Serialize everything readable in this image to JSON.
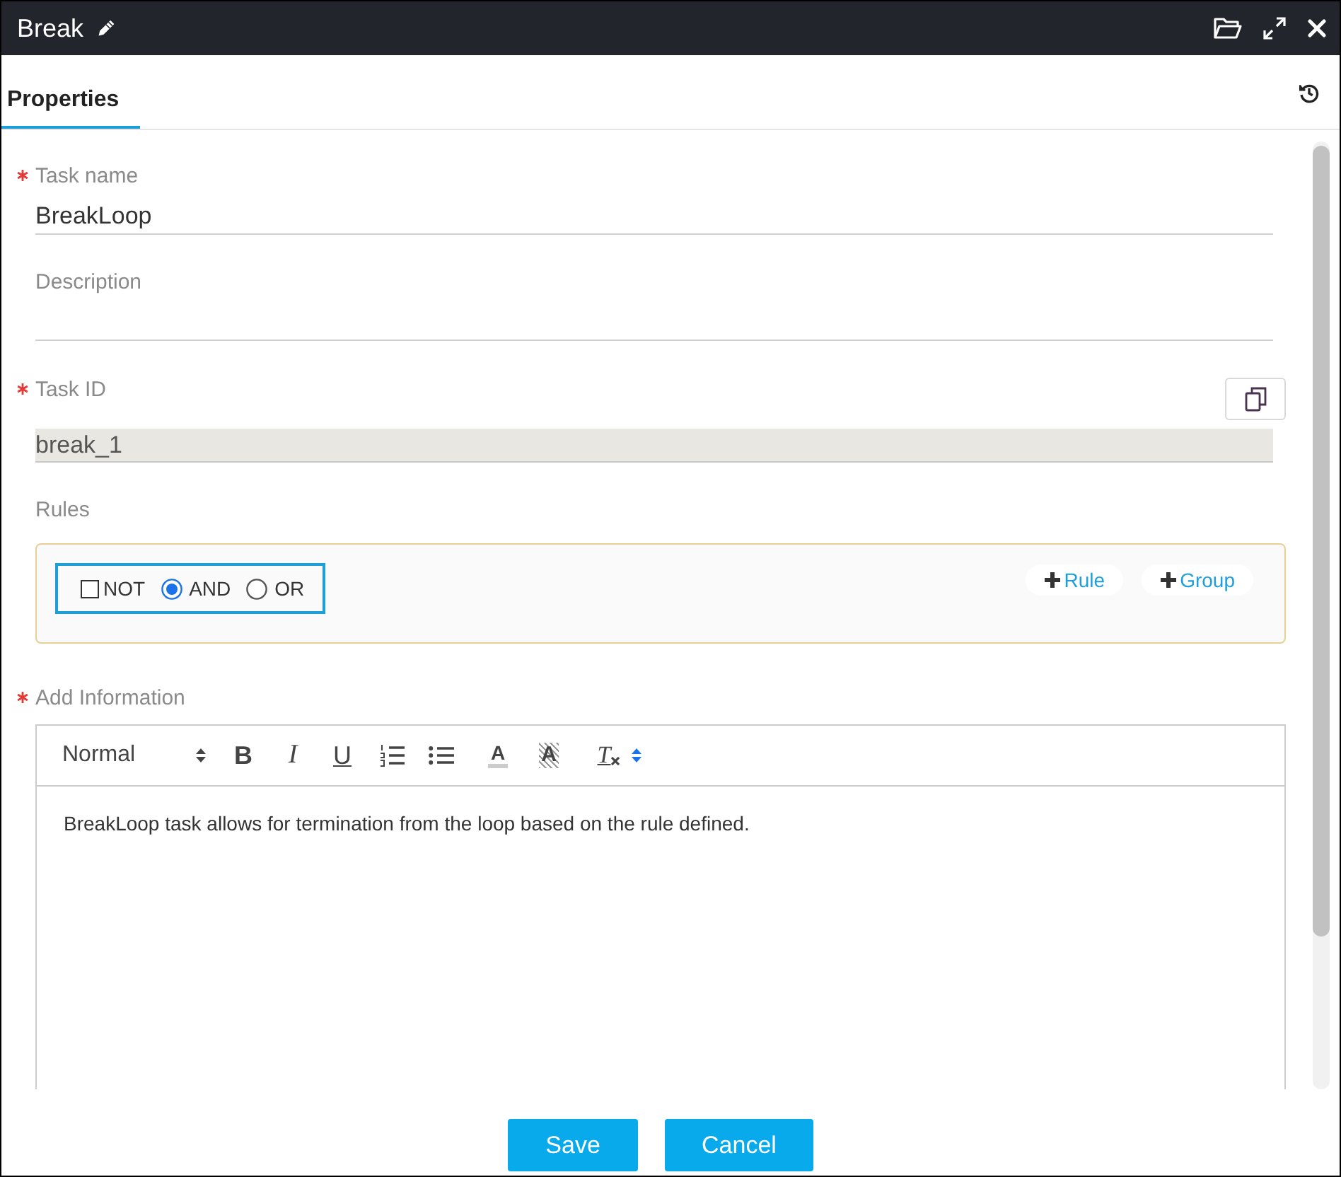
{
  "window": {
    "title": "Break"
  },
  "tabs": [
    {
      "label": "Properties",
      "selected": true
    }
  ],
  "fields": [
    {
      "kind": "text",
      "label": "Task name",
      "required": true,
      "value": "BreakLoop"
    },
    {
      "kind": "text",
      "label": "Description",
      "required": false
    },
    {
      "kind": "readonly",
      "label": "Task ID",
      "required": true,
      "value": "break_1",
      "copy_button": true
    }
  ],
  "rules": {
    "label": "Rules",
    "operators": [
      {
        "kind": "checkbox",
        "label": "NOT",
        "checked": false
      },
      {
        "kind": "radio",
        "label": "AND",
        "selected": true
      },
      {
        "kind": "radio",
        "label": "OR",
        "selected": false
      }
    ],
    "buttons": [
      {
        "label": "Rule"
      },
      {
        "label": "Group"
      }
    ]
  },
  "add_information": {
    "label": "Add Information",
    "required": true,
    "toolbar": [
      {
        "kind": "format",
        "label": "Normal"
      },
      {
        "kind": "bold",
        "label": "B"
      },
      {
        "kind": "italic",
        "label": "I"
      },
      {
        "kind": "underline",
        "label": "U"
      },
      {
        "kind": "ordered-list"
      },
      {
        "kind": "bullet-list"
      },
      {
        "kind": "text-color",
        "label": "A"
      },
      {
        "kind": "background",
        "label": "A"
      },
      {
        "kind": "clean",
        "label": "T"
      },
      {
        "kind": "picker"
      }
    ],
    "text": "BreakLoop task allows for termination from the loop based on the rule defined."
  },
  "buttons": [
    {
      "label": "Save"
    },
    {
      "label": "Cancel"
    }
  ]
}
